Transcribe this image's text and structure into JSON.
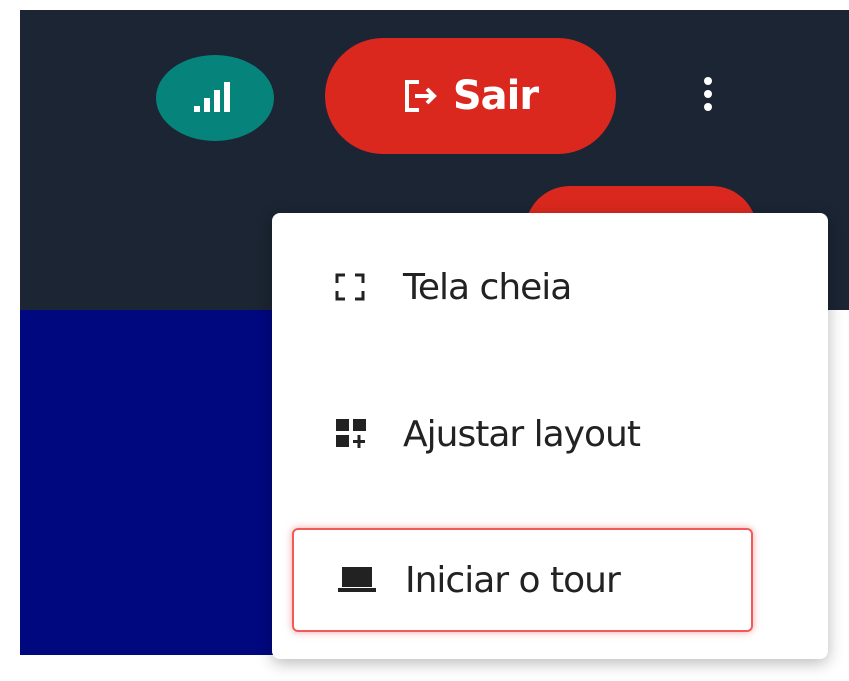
{
  "header": {
    "status_icon": "signal-bars-icon",
    "logout": {
      "label": "Sair",
      "icon": "logout-icon",
      "color": "#da281e"
    },
    "more_icon": "more-vertical-icon"
  },
  "menu": {
    "items": [
      {
        "label": "Tela cheia",
        "icon": "fullscreen-icon"
      },
      {
        "label": "Ajustar layout",
        "icon": "layout-grid-icon"
      },
      {
        "label": "Iniciar o tour",
        "icon": "laptop-icon",
        "highlighted": true
      }
    ]
  },
  "colors": {
    "header_bg": "#1b2533",
    "main_bg": "#00087f",
    "status_green": "#06847b",
    "danger_red": "#da281e",
    "highlight_border": "#ef5b5b"
  }
}
